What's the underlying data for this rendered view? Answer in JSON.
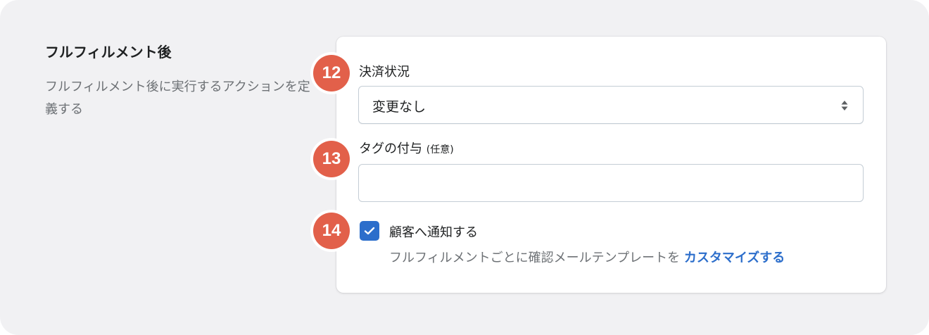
{
  "section": {
    "title": "フルフィルメント後",
    "description": "フルフィルメント後に実行するアクションを定義する"
  },
  "payment_status": {
    "badge": "12",
    "label": "決済状況",
    "selected": "変更なし"
  },
  "tags": {
    "badge": "13",
    "label": "タグの付与",
    "optional": "(任意)",
    "value": ""
  },
  "notify": {
    "badge": "14",
    "label": "顧客へ通知する",
    "checked": true,
    "help_text": "フルフィルメントごとに確認メールテンプレートを",
    "link_text": "カスタマイズする"
  },
  "colors": {
    "badge": "#e2604a",
    "accent": "#2c6ecb",
    "background": "#f1f1f3"
  },
  "icons": {
    "select": "select-arrows-icon",
    "checkbox": "checkmark-icon"
  }
}
